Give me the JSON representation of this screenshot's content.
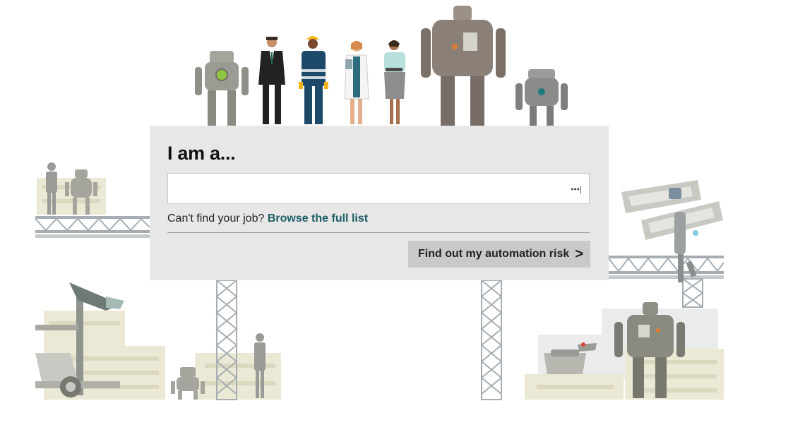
{
  "form": {
    "heading": "I am a...",
    "search_placeholder": "",
    "hint_text": "Can't find your job?",
    "browse_link": "Browse the full list",
    "submit_label": "Find out my automation risk",
    "submit_chevron": ">",
    "autofill_icon": "•••|"
  },
  "colors": {
    "panel_bg": "#e7e7e7",
    "link": "#1d5e66",
    "button_bg": "#c9c9c9",
    "scaffold": "#a6aeb3",
    "crate": "#ebe8d5",
    "robot_grey": "#8a8a80"
  },
  "illustration": {
    "characters": [
      "robot-small-green-eye-icon",
      "businessman-icon",
      "construction-worker-icon",
      "doctor-icon",
      "office-worker-icon",
      "robot-large-icon",
      "robot-round-icon"
    ],
    "background_items": [
      "scaffold-icon",
      "crate-icon",
      "forklift-icon",
      "robot-dog-icon",
      "robot-carrying-boxes-icon"
    ]
  }
}
